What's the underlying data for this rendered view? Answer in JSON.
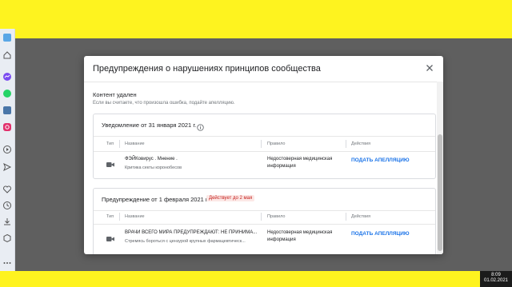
{
  "modal": {
    "title": "Предупреждения о нарушениях принципов сообщества"
  },
  "section": {
    "title": "Контент удален",
    "subtitle": "Если вы считаете, что произошла ошибка, подайте апелляцию."
  },
  "columns": {
    "type": "Тип",
    "name": "Название",
    "rule": "Правило",
    "actions": "Действия"
  },
  "cards": [
    {
      "heading": "Уведомление от 31 января 2021 г.",
      "row": {
        "title": "ФЭЙКовирус . Мнение .",
        "subtitle": "Критика секты коронобесов",
        "rule": "Недостоверная медицинская информация",
        "action": "ПОДАТЬ АПЕЛЛЯЦИЮ"
      }
    },
    {
      "heading": "Предупреждение от 1 февраля 2021 г.",
      "badge": "Действует до 2 мая",
      "row": {
        "title": "ВРАЧИ ВСЕГО МИРА ПРЕДУПРЕЖДАЮТ: НЕ ПРИНИМА...",
        "subtitle": "Стремясь бороться с цензурой крупных фармацевтическ...",
        "rule": "Недостоверная медицинская информация",
        "action": "ПОДАТЬ АПЕЛЛЯЦИЮ"
      }
    }
  ],
  "taskbar": {
    "time": "8:09",
    "date": "01.02.2021"
  },
  "colors": {
    "accent": "#1a73e8",
    "warning_badge": "#c5221f",
    "yellow": "#fef31f"
  }
}
